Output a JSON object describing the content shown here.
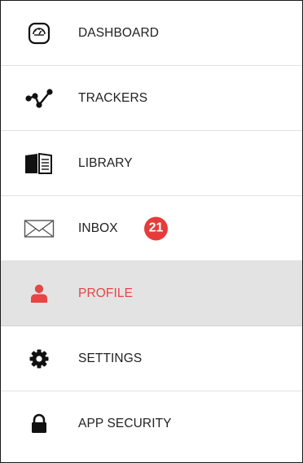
{
  "colors": {
    "accent": "#e84545",
    "active_background": "#e3e3e3",
    "text": "#222222",
    "badge": "#e63b3b"
  },
  "menu": {
    "items": [
      {
        "label": "DASHBOARD",
        "icon": "dashboard-gauge-icon",
        "active": false
      },
      {
        "label": "TRACKERS",
        "icon": "trackers-graph-icon",
        "active": false
      },
      {
        "label": "LIBRARY",
        "icon": "library-book-icon",
        "active": false
      },
      {
        "label": "INBOX",
        "icon": "inbox-envelope-icon",
        "active": false,
        "badge": "21"
      },
      {
        "label": "PROFILE",
        "icon": "profile-person-icon",
        "active": true
      },
      {
        "label": "SETTINGS",
        "icon": "settings-gear-icon",
        "active": false
      },
      {
        "label": "APP SECURITY",
        "icon": "lock-icon",
        "active": false
      }
    ]
  }
}
